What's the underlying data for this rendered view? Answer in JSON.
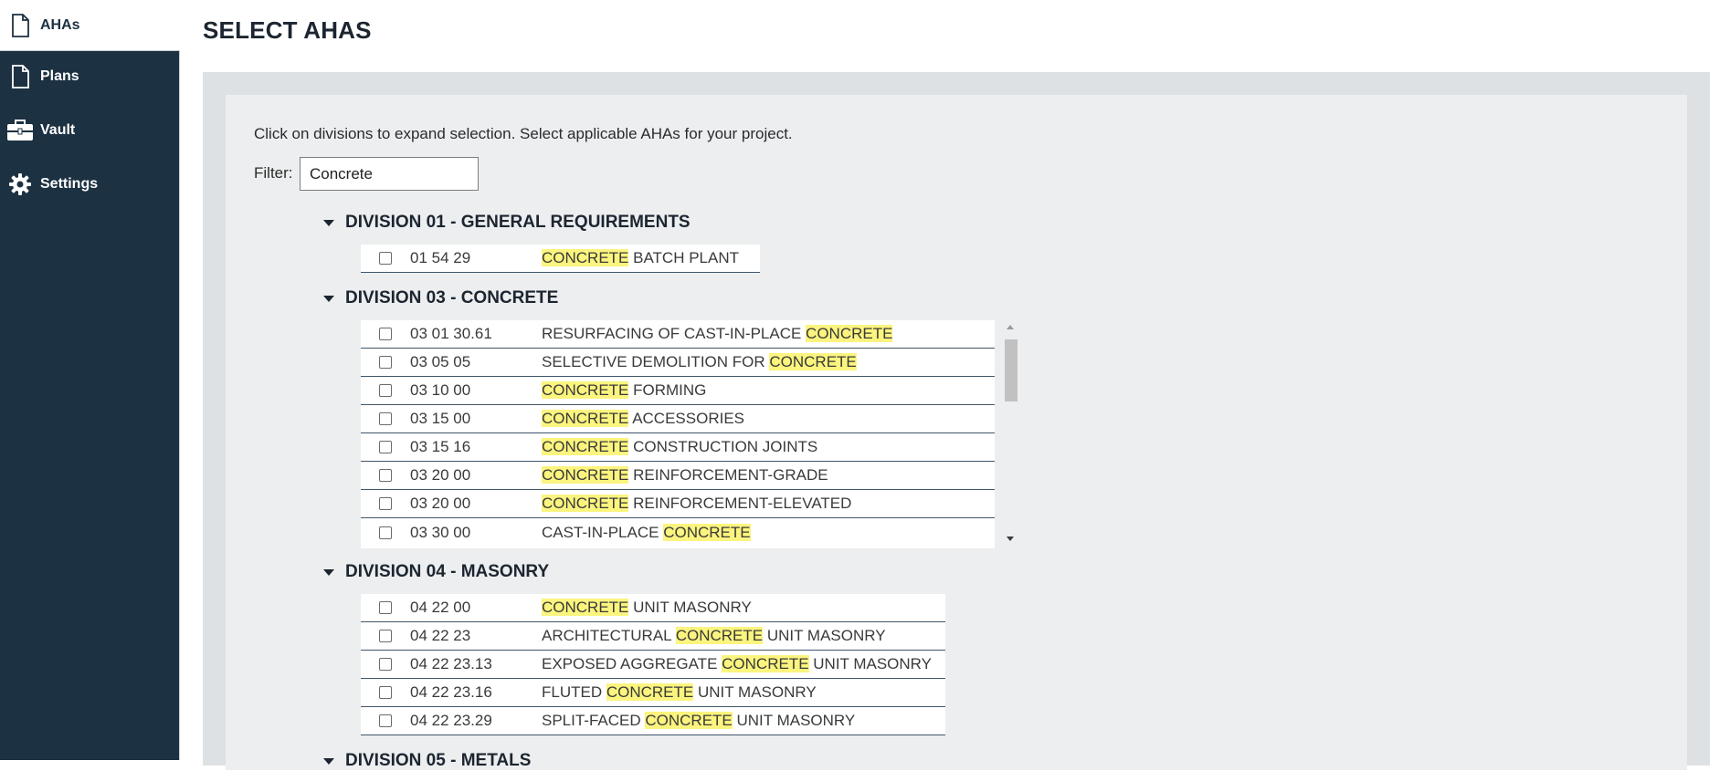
{
  "sidebar": {
    "items": [
      {
        "label": "AHAs",
        "icon": "document-icon",
        "active": true
      },
      {
        "label": "Plans",
        "icon": "document-icon",
        "active": false
      },
      {
        "label": "Vault",
        "icon": "briefcase-icon",
        "active": false
      },
      {
        "label": "Settings",
        "icon": "gear-icon",
        "active": false
      }
    ]
  },
  "page": {
    "title": "SELECT AHAS",
    "instructions": "Click on divisions to expand selection. Select applicable AHAs for your project.",
    "filter_label": "Filter:",
    "filter_value": "Concrete"
  },
  "colors": {
    "sidebar_bg": "#1c3142",
    "highlight": "#fbf47e",
    "panel_outer": "#dde1e4",
    "panel_inner": "#eceeef"
  },
  "divisions": [
    {
      "title": "DIVISION 01 - GENERAL REQUIREMENTS",
      "items": [
        {
          "code": "01 54 29",
          "pre": "",
          "match": "CONCRETE",
          "post": " BATCH PLANT"
        }
      ]
    },
    {
      "title": "DIVISION 03 - CONCRETE",
      "items": [
        {
          "code": "03 01 30.61",
          "pre": "RESURFACING OF CAST-IN-PLACE ",
          "match": "CONCRETE",
          "post": ""
        },
        {
          "code": "03 05 05",
          "pre": "SELECTIVE DEMOLITION FOR ",
          "match": "CONCRETE",
          "post": ""
        },
        {
          "code": "03 10 00",
          "pre": "",
          "match": "CONCRETE",
          "post": " FORMING"
        },
        {
          "code": "03 15 00",
          "pre": "",
          "match": "CONCRETE",
          "post": " ACCESSORIES"
        },
        {
          "code": "03 15 16",
          "pre": "",
          "match": "CONCRETE",
          "post": " CONSTRUCTION JOINTS"
        },
        {
          "code": "03 20 00",
          "pre": "",
          "match": "CONCRETE",
          "post": " REINFORCEMENT-GRADE"
        },
        {
          "code": "03 20 00",
          "pre": "",
          "match": "CONCRETE",
          "post": " REINFORCEMENT-ELEVATED"
        },
        {
          "code": "03 30 00",
          "pre": "CAST-IN-PLACE ",
          "match": "CONCRETE",
          "post": ""
        }
      ]
    },
    {
      "title": "DIVISION 04 - MASONRY",
      "items": [
        {
          "code": "04 22 00",
          "pre": "",
          "match": "CONCRETE",
          "post": " UNIT MASONRY"
        },
        {
          "code": "04 22 23",
          "pre": "ARCHITECTURAL ",
          "match": "CONCRETE",
          "post": " UNIT MASONRY"
        },
        {
          "code": "04 22 23.13",
          "pre": "EXPOSED AGGREGATE ",
          "match": "CONCRETE",
          "post": " UNIT MASONRY"
        },
        {
          "code": "04 22 23.16",
          "pre": "FLUTED ",
          "match": "CONCRETE",
          "post": " UNIT MASONRY"
        },
        {
          "code": "04 22 23.29",
          "pre": "SPLIT-FACED ",
          "match": "CONCRETE",
          "post": " UNIT MASONRY"
        }
      ]
    },
    {
      "title": "DIVISION 05 - METALS",
      "items": []
    }
  ]
}
